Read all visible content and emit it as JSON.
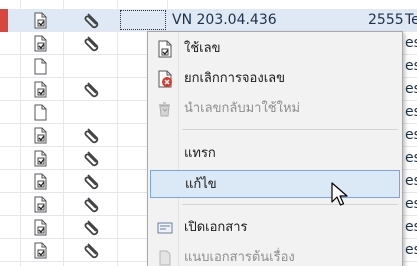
{
  "grid": {
    "selected_row": {
      "number": "VN 203.04.436",
      "count": "2555",
      "trailing": "Tes"
    },
    "rows_trailing": [
      "Tes",
      "es",
      "est",
      "es",
      "es",
      "es",
      "es",
      "es",
      "es",
      "es",
      "es"
    ]
  },
  "menu": {
    "items": [
      {
        "label": "ใช้เลข",
        "icon": "doc-check-icon",
        "enabled": true
      },
      {
        "label": "ยกเลิกการจองเลข",
        "icon": "cancel-doc-icon",
        "enabled": true
      },
      {
        "label": "นำเลขกลับมาใช้ใหม่",
        "icon": "recycle-icon",
        "enabled": false
      },
      {
        "label": "แทรก",
        "icon": "",
        "enabled": true
      },
      {
        "label": "แก้ไข",
        "icon": "",
        "enabled": true,
        "hovered": true
      },
      {
        "label": "เปิดเอกสาร",
        "icon": "open-document-icon",
        "enabled": true
      },
      {
        "label": "แนบเอกสารต้นเรื่อง",
        "icon": "attach-document-icon",
        "enabled": false
      }
    ]
  },
  "colors": {
    "row_marker": "#d9463d",
    "selection": "#dfe9f6",
    "menu_hover": "#dbe8f6"
  }
}
